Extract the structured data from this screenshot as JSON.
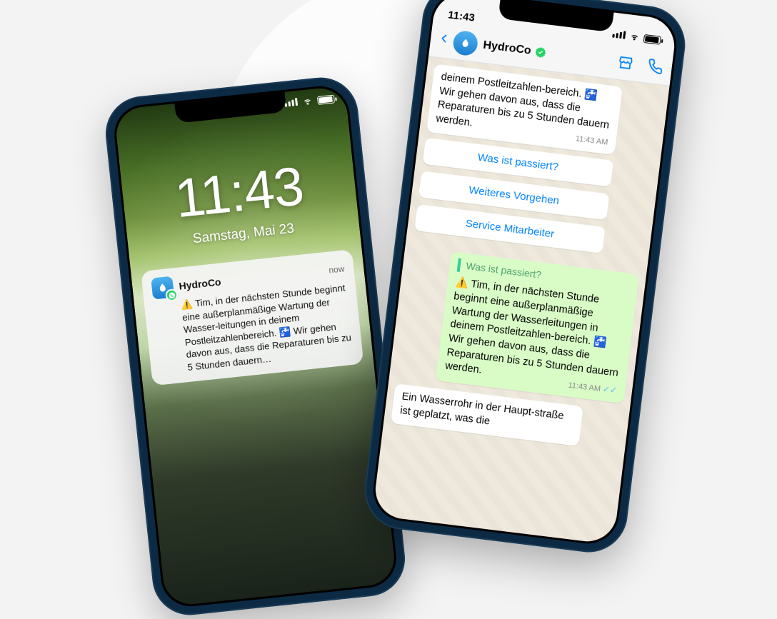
{
  "lockscreen": {
    "time": "11:43",
    "date": "Samstag, Mai 23",
    "notification": {
      "app": "HydroCo",
      "when": "now",
      "body": "⚠️ Tim, in der nächsten Stunde beginnt eine außerplanmäßige Wartung der Wasser-leitungen in deinem Postleitzahlenbereich. 🚰 Wir gehen davon aus, dass die Reparaturen bis zu 5 Stunden dauern…"
    }
  },
  "chat": {
    "status_time": "11:43",
    "contact": "HydroCo",
    "messages": {
      "in_top": "deinem Postleitzahlen-bereich. 🚰 Wir gehen davon aus, dass die Reparaturen bis zu 5 Stunden dauern werden.",
      "in_top_time": "11:43 AM",
      "quick": [
        "Was ist passiert?",
        "Weiteres Vorgehen",
        "Service Mitarbeiter"
      ],
      "out_quote": "Was ist passiert?",
      "out_body": "⚠️ Tim, in der nächsten Stunde beginnt eine außerplanmäßige Wartung der Wasserleitungen in deinem Postleitzahlen-bereich. 🚰 Wir gehen davon aus, dass die Reparaturen bis zu 5 Stunden dauern werden.",
      "out_time": "11:43 AM",
      "in_bottom": "Ein Wasserrohr in der Haupt-straße ist geplatzt, was die"
    }
  }
}
